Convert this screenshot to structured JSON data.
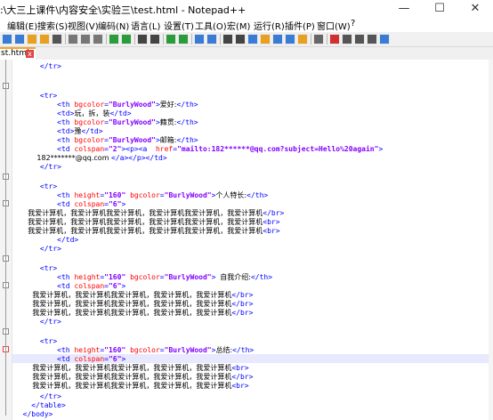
{
  "window": {
    "title": ":\\大三上课件\\内容安全\\实验三\\test.html - Notepad++",
    "minimize": "—",
    "maximize": "☐",
    "close": "✕"
  },
  "menu": [
    "编辑(E)",
    "搜索(S)",
    "视图(V)",
    "编码(N)",
    "语言(L)",
    "设置(T)",
    "工具(O)",
    "宏(M)",
    "运行(R)",
    "插件(P)",
    "窗口(W)",
    "?"
  ],
  "toolbar_icons": [
    "save-icon",
    "save-all-icon",
    "close-icon",
    "close-all-icon",
    "print-icon",
    "cut-icon",
    "copy-icon",
    "paste-icon",
    "undo-icon",
    "redo-icon",
    "find-icon",
    "replace-icon",
    "zoom-in-icon",
    "zoom-out-icon",
    "sync-v-icon",
    "sync-h-icon",
    "word-wrap-icon",
    "show-all-icon",
    "indent-guide-icon",
    "udl-icon",
    "doc-map-icon",
    "function-list-icon",
    "folder-workspace-icon",
    "monitor-icon",
    "record-macro-icon",
    "stop-record-icon",
    "play-macro-icon",
    "play-multiple-icon",
    "save-macro-icon"
  ],
  "tab": {
    "label": "st.html",
    "close": "x"
  },
  "editor": {
    "lines": [
      [
        [
          "tag",
          "      </tr>"
        ]
      ],
      [],
      [
        [
          "tag",
          "      <tr>"
        ]
      ],
      [
        [
          "tag",
          "          <th "
        ],
        [
          "attr",
          "bgcolor"
        ],
        [
          "tag",
          "="
        ],
        [
          "val",
          "\"BurlyWood\""
        ],
        [
          "tag",
          ">"
        ],
        [
          "txt",
          "爱好:"
        ],
        [
          "tag",
          "</th>"
        ]
      ],
      [
        [
          "tag",
          "          <td>"
        ],
        [
          "txt",
          "玩，拆，装"
        ],
        [
          "tag",
          "</td>"
        ]
      ],
      [
        [
          "tag",
          "          <th "
        ],
        [
          "attr",
          "bgcolor"
        ],
        [
          "tag",
          "="
        ],
        [
          "val",
          "\"BurlyWood\""
        ],
        [
          "tag",
          ">"
        ],
        [
          "txt",
          "籍贯:"
        ],
        [
          "tag",
          "</th>"
        ]
      ],
      [
        [
          "tag",
          "          <td>"
        ],
        [
          "txt",
          "豫"
        ],
        [
          "tag",
          "</td>"
        ]
      ],
      [
        [
          "tag",
          "          <th "
        ],
        [
          "attr",
          "bgcolor"
        ],
        [
          "tag",
          "="
        ],
        [
          "val",
          "\"BurlyWood\""
        ],
        [
          "tag",
          ">"
        ],
        [
          "txt",
          "邮箱:"
        ],
        [
          "tag",
          "</th>"
        ]
      ],
      [
        [
          "tag",
          "          <td "
        ],
        [
          "attr",
          "colspan"
        ],
        [
          "tag",
          "="
        ],
        [
          "val",
          "\"2\""
        ],
        [
          "tag",
          "><p><a  "
        ],
        [
          "attr",
          "href"
        ],
        [
          "tag",
          "="
        ],
        [
          "val",
          "\"mailto:182******@qq.com?subject=Hello%20again\""
        ],
        [
          "tag",
          ">"
        ]
      ],
      [
        [
          "txt",
          "          182*******@qq.com "
        ],
        [
          "tag",
          "</a></p></td>"
        ]
      ],
      [
        [
          "tag",
          "      </tr>"
        ]
      ],
      [],
      [
        [
          "tag",
          "      <tr>"
        ]
      ],
      [
        [
          "tag",
          "          <th "
        ],
        [
          "attr",
          "height"
        ],
        [
          "tag",
          "="
        ],
        [
          "val",
          "\"160\" "
        ],
        [
          "attr",
          "bgcolor"
        ],
        [
          "tag",
          "="
        ],
        [
          "val",
          "\"BurlyWood\""
        ],
        [
          "tag",
          ">"
        ],
        [
          "txt",
          "个人特长:"
        ],
        [
          "tag",
          "</th>"
        ]
      ],
      [
        [
          "tag",
          "          <td "
        ],
        [
          "attr",
          "colspan"
        ],
        [
          "tag",
          "="
        ],
        [
          "val",
          "\"6\""
        ],
        [
          "tag",
          ">"
        ]
      ],
      [
        [
          "txt",
          "      我爱计算机，我爱计算机我爱计算机，我爱计算机我爱计算机，我爱计算机"
        ],
        [
          "tag",
          "</br>"
        ]
      ],
      [
        [
          "txt",
          "      我爱计算机，我爱计算机我爱计算机，我爱计算机我爱计算机，我爱计算机"
        ],
        [
          "tag",
          "<br>"
        ]
      ],
      [
        [
          "txt",
          "      我爱计算机，我爱计算机我爱计算机，我爱计算机我爱计算机，我爱计算机"
        ],
        [
          "tag",
          "<br>"
        ]
      ],
      [
        [
          "tag",
          "          </td>"
        ]
      ],
      [
        [
          "tag",
          "      </tr>"
        ]
      ],
      [],
      [
        [
          "tag",
          "      <tr>"
        ]
      ],
      [
        [
          "tag",
          "          <th "
        ],
        [
          "attr",
          "height"
        ],
        [
          "tag",
          "="
        ],
        [
          "val",
          "\"160\" "
        ],
        [
          "attr",
          "bgcolor"
        ],
        [
          "tag",
          "="
        ],
        [
          "val",
          "\"BurlyWood\""
        ],
        [
          "tag",
          "> "
        ],
        [
          "txt",
          "自我介绍:"
        ],
        [
          "tag",
          "</th>"
        ]
      ],
      [
        [
          "tag",
          "          <td "
        ],
        [
          "attr",
          "colspan"
        ],
        [
          "tag",
          "="
        ],
        [
          "val",
          "\"6\""
        ],
        [
          "tag",
          ">"
        ]
      ],
      [
        [
          "txt",
          "        我爱计算机，我爱计算机我爱计算机，我爱计算机，我爱计算机"
        ],
        [
          "tag",
          "</br>"
        ]
      ],
      [
        [
          "txt",
          "        我爱计算机，我爱计算机我爱计算机，我爱计算机，我爱计算机"
        ],
        [
          "tag",
          "</br>"
        ]
      ],
      [
        [
          "txt",
          "        我爱计算机，我爱计算机我爱计算机，我爱计算机，我爱计算机"
        ],
        [
          "tag",
          "</br>"
        ]
      ],
      [
        [
          "tag",
          "      </tr>"
        ]
      ],
      [],
      [
        [
          "tag",
          "      <tr>"
        ]
      ],
      [
        [
          "tag",
          "          <th "
        ],
        [
          "attr",
          "height"
        ],
        [
          "tag",
          "="
        ],
        [
          "val",
          "\"160\" "
        ],
        [
          "attr",
          "bgcolor"
        ],
        [
          "tag",
          "="
        ],
        [
          "val",
          "\"BurlyWood\""
        ],
        [
          "tag",
          ">"
        ],
        [
          "txt",
          "总结:"
        ],
        [
          "tag",
          "</th>"
        ]
      ],
      [
        [
          "tag",
          "          <td "
        ],
        [
          "attr",
          "colspan"
        ],
        [
          "tag",
          "="
        ],
        [
          "val",
          "\"6\""
        ],
        [
          "tag",
          ">"
        ]
      ],
      [
        [
          "txt",
          "        我爱计算机，我爱计算机我爱计算机，我爱计算机，我爱计算机"
        ],
        [
          "tag",
          "<br>"
        ]
      ],
      [
        [
          "txt",
          "        我爱计算机，我爱计算机我爱计算机，我爱计算机，我爱计算机"
        ],
        [
          "tag",
          "</br>"
        ]
      ],
      [
        [
          "txt",
          "        我爱计算机，我爱计算机我爱计算机，我爱计算机，我爱计算机"
        ],
        [
          "tag",
          "<br>"
        ]
      ],
      [
        [
          "tag",
          "      </tr>"
        ]
      ],
      [
        [
          "tag",
          "    </table>"
        ]
      ],
      [
        [
          "tag",
          "  </body>"
        ]
      ],
      [],
      [
        [
          "tag",
          "</html>"
        ]
      ]
    ]
  },
  "colors": {
    "tag": "#0000ff",
    "attr": "#ff0000",
    "value": "#8000ff",
    "text": "#000000",
    "tab_accent": "#f5a623",
    "current_line": "#e8e8ff"
  }
}
